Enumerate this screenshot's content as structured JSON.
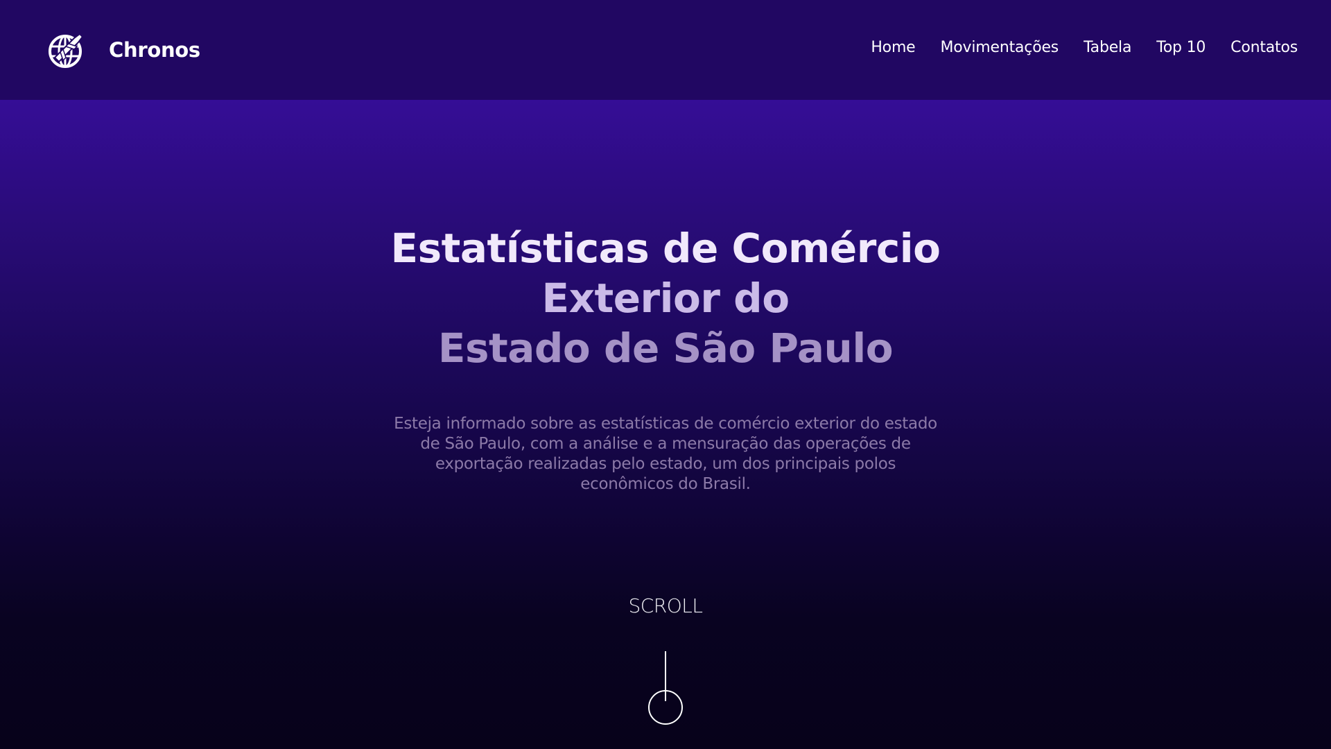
{
  "brand": {
    "name": "Chronos",
    "icon": "globe-plane-icon"
  },
  "nav": {
    "items": [
      {
        "label": "Home"
      },
      {
        "label": "Movimentações"
      },
      {
        "label": "Tabela"
      },
      {
        "label": "Top 10"
      },
      {
        "label": "Contatos"
      }
    ]
  },
  "hero": {
    "title_lines": [
      "Estatísticas de Comércio",
      "Exterior do",
      "Estado de São Paulo"
    ],
    "description": "Esteja informado sobre as estatísticas de comércio exterior do estado de São Paulo, com a análise e a mensuração das operações de exportação realizadas pelo estado, um dos principais polos econômicos do Brasil.",
    "scroll_label": "SCROLL",
    "scroll_icon": "scroll-down-indicator-icon"
  },
  "colors": {
    "header_bg": "#210762",
    "hero_top": "#350d96",
    "hero_bottom": "#07021a",
    "title_line1": "#f1e9fb",
    "title_line2": "#cbbbe8",
    "title_line3": "#a592c6",
    "description": "#8c7aa8"
  }
}
